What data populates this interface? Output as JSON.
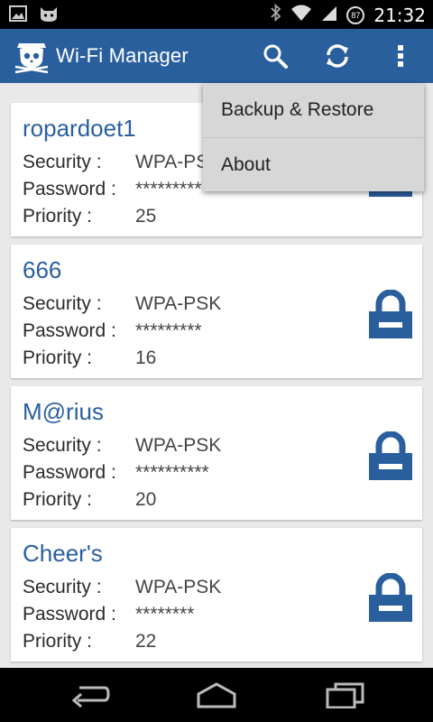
{
  "status_bar": {
    "time": "21:32",
    "battery_percent": "87",
    "icons": [
      "image-icon",
      "cat-icon",
      "bluetooth-icon",
      "wifi-icon",
      "signal-icon",
      "battery-icon"
    ]
  },
  "action_bar": {
    "title": "Wi-Fi Manager",
    "color": "#2a5f9e",
    "icons": [
      "pirate-logo-icon",
      "search-icon",
      "refresh-icon",
      "overflow-menu-icon"
    ]
  },
  "labels": {
    "security": "Security :",
    "password": "Password :",
    "priority": "Priority :"
  },
  "networks": [
    {
      "ssid": "ropardoet1",
      "security": "WPA-PSK",
      "password": "*********",
      "priority": "25"
    },
    {
      "ssid": "666",
      "security": "WPA-PSK",
      "password": "*********",
      "priority": "16"
    },
    {
      "ssid": "M@rius",
      "security": "WPA-PSK",
      "password": "**********",
      "priority": "20"
    },
    {
      "ssid": "Cheer's",
      "security": "WPA-PSK",
      "password": "********",
      "priority": "22"
    }
  ],
  "overflow_menu": {
    "items": [
      "Backup & Restore",
      "About"
    ]
  },
  "nav_bar": {
    "icons": [
      "back-icon",
      "home-icon",
      "recents-icon"
    ]
  }
}
